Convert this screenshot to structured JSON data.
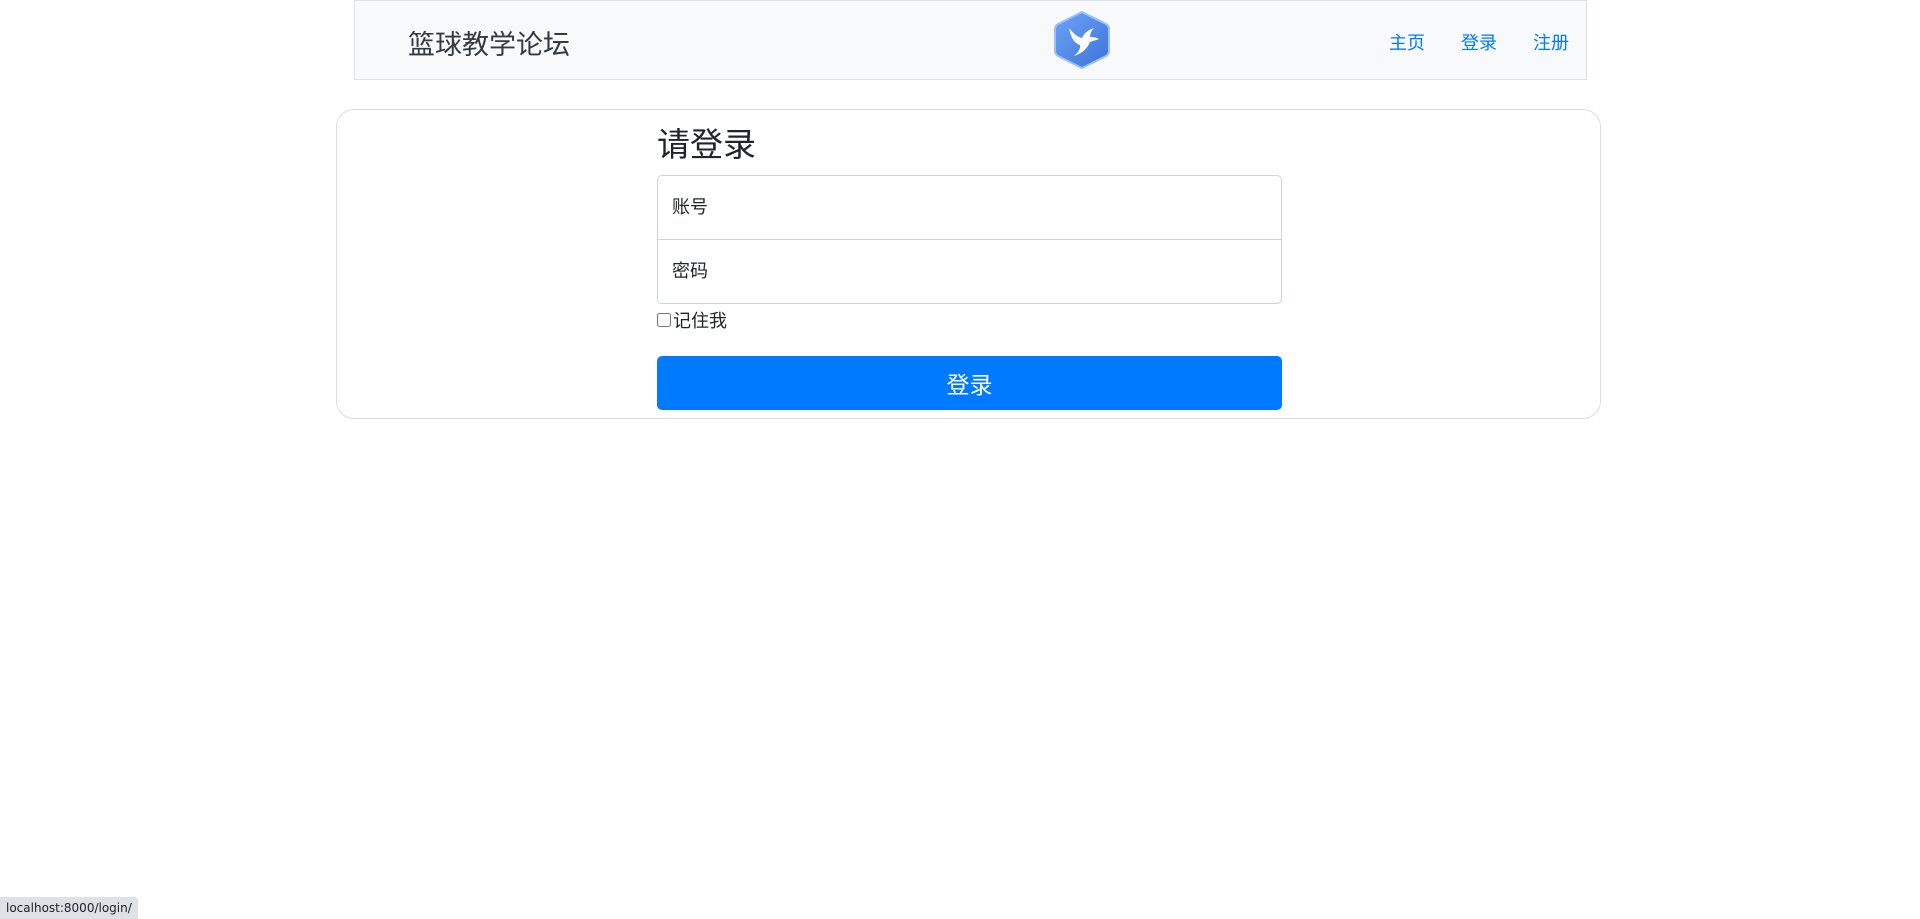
{
  "navbar": {
    "brand": "篮球教学论坛",
    "logo_icon": "hummingbird-hexagon-logo",
    "links": [
      {
        "label": "主页"
      },
      {
        "label": "登录"
      },
      {
        "label": "注册"
      }
    ]
  },
  "login": {
    "heading": "请登录",
    "account_placeholder": "账号",
    "password_placeholder": "密码",
    "remember_label": "记住我",
    "remember_checked": false,
    "submit_label": "登录"
  },
  "statusbar": {
    "url": "localhost:8000/login/"
  },
  "colors": {
    "primary": "#007bff",
    "navbar_bg": "#f8f9fa",
    "logo_blue": "#4a86e8"
  }
}
